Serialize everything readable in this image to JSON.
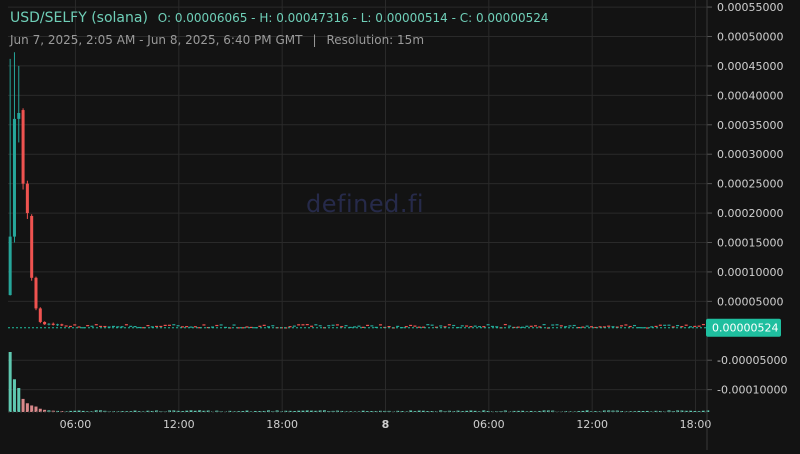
{
  "header": {
    "pair": "USD/SELFY (solana)",
    "ohlc": "O: 0.00006065 - H: 0.00047316 - L: 0.00000514 - C: 0.00000524",
    "date_range": "Jun 7, 2025, 2:05 AM - Jun 8, 2025, 6:40 PM GMT",
    "separator": "|",
    "resolution": "Resolution: 15m"
  },
  "watermark": "defined.fi",
  "colors": {
    "background": "#131313",
    "grid": "#2a2a2a",
    "up": "#26a69a",
    "down": "#ef5350",
    "up_volume": "#5fc8b0",
    "down_volume": "#d8888a",
    "text": "#cfcfcf",
    "price_tag": "#1fbf9f"
  },
  "last_price_label": "0.00000524",
  "chart_data": {
    "type": "candlestick",
    "x_tick_labels": [
      "06:00",
      "12:00",
      "18:00",
      "8",
      "06:00",
      "12:00",
      "18:00"
    ],
    "y_tick_labels": [
      "0.00055000",
      "0.00050000",
      "0.00045000",
      "0.00040000",
      "0.00035000",
      "0.00030000",
      "0.00025000",
      "0.00020000",
      "0.00015000",
      "0.00010000",
      "0.00005000",
      "-0.00005000",
      "-0.00010000"
    ],
    "y_ticks": [
      0.00055,
      0.0005,
      0.00045,
      0.0004,
      0.00035,
      0.0003,
      0.00025,
      0.0002,
      0.00015,
      0.0001,
      5e-05,
      -5e-05,
      -0.0001
    ],
    "ylim": [
      -0.000138,
      0.000562
    ],
    "x_start": "2025-06-07T02:05Z",
    "x_end": "2025-06-08T18:40Z",
    "x_tick_times": [
      "2025-06-07T06:00Z",
      "2025-06-07T12:00Z",
      "2025-06-07T18:00Z",
      "2025-06-08T00:00Z",
      "2025-06-08T06:00Z",
      "2025-06-08T12:00Z",
      "2025-06-08T18:00Z"
    ],
    "candle_interval_minutes": 15,
    "candles": [
      {
        "t": "2025-06-07T02:05Z",
        "o": 6.065e-05,
        "h": 0.000462,
        "l": 6e-05,
        "c": 0.00016,
        "v": 55
      },
      {
        "t": "2025-06-07T02:20Z",
        "o": 0.00016,
        "h": 0.00047316,
        "l": 0.00015,
        "c": 0.00036,
        "v": 30
      },
      {
        "t": "2025-06-07T02:35Z",
        "o": 0.00036,
        "h": 0.00045,
        "l": 0.00032,
        "c": 0.00037,
        "v": 22
      },
      {
        "t": "2025-06-07T02:50Z",
        "o": 0.000375,
        "h": 0.000378,
        "l": 0.00024,
        "c": 0.00025,
        "v": 12
      },
      {
        "t": "2025-06-07T03:05Z",
        "o": 0.00025,
        "h": 0.000255,
        "l": 0.00019,
        "c": 0.0002,
        "v": 8
      },
      {
        "t": "2025-06-07T03:20Z",
        "o": 0.000195,
        "h": 0.000198,
        "l": 8.5e-05,
        "c": 9e-05,
        "v": 6
      },
      {
        "t": "2025-06-07T03:35Z",
        "o": 9e-05,
        "h": 9.2e-05,
        "l": 3.5e-05,
        "c": 3.8e-05,
        "v": 5
      },
      {
        "t": "2025-06-07T03:50Z",
        "o": 3.8e-05,
        "h": 4e-05,
        "l": 1.3e-05,
        "c": 1.5e-05,
        "v": 3
      },
      {
        "t": "2025-06-07T04:05Z",
        "o": 1.5e-05,
        "h": 1.6e-05,
        "l": 1e-05,
        "c": 1.1e-05,
        "v": 2
      },
      {
        "t": "2025-06-07T04:20Z",
        "o": 1.1e-05,
        "h": 1.3e-05,
        "l": 9e-06,
        "c": 1.2e-05,
        "v": 1.5
      },
      {
        "t": "2025-06-07T04:35Z",
        "o": 1.2e-05,
        "h": 1.4e-05,
        "l": 9e-06,
        "c": 1e-05,
        "v": 1.2
      },
      {
        "t": "2025-06-07T04:50Z",
        "o": 1e-05,
        "h": 1.2e-05,
        "l": 8e-06,
        "c": 1.1e-05,
        "v": 1
      },
      {
        "t": "2025-06-07T05:05Z",
        "o": 1.1e-05,
        "h": 1.2e-05,
        "l": 8e-06,
        "c": 9e-06,
        "v": 0.8
      }
    ],
    "tail": {
      "from": "2025-06-07T05:20Z",
      "to": "2025-06-08T18:40Z",
      "price_band": [
        4e-06,
        1e-05
      ],
      "close": 5.24e-06
    },
    "volume_max": 55
  }
}
